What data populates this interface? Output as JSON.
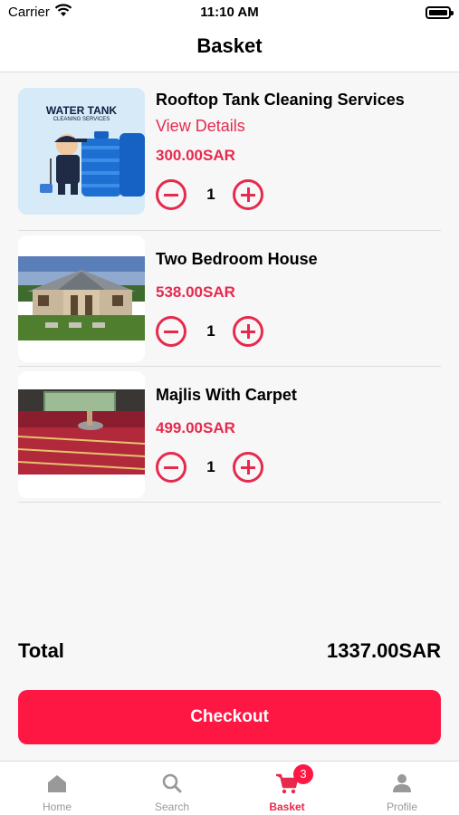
{
  "status_bar": {
    "carrier": "Carrier",
    "time": "11:10 AM"
  },
  "header": {
    "title": "Basket"
  },
  "items": [
    {
      "name": "Rooftop Tank Cleaning Services",
      "details_link": "View Details",
      "price": "300.00SAR",
      "quantity": "1",
      "image_text": {
        "title": "WATER TANK",
        "subtitle": "CLEANING SERVICES"
      }
    },
    {
      "name": "Two Bedroom House",
      "price": "538.00SAR",
      "quantity": "1"
    },
    {
      "name": "Majlis With Carpet",
      "price": "499.00SAR",
      "quantity": "1"
    }
  ],
  "summary": {
    "total_label": "Total",
    "total_value": "1337.00SAR"
  },
  "checkout_label": "Checkout",
  "tabs": [
    {
      "label": "Home",
      "icon": "home-icon"
    },
    {
      "label": "Search",
      "icon": "search-icon"
    },
    {
      "label": "Basket",
      "icon": "cart-icon",
      "badge": "3",
      "active": true
    },
    {
      "label": "Profile",
      "icon": "profile-icon"
    }
  ],
  "colors": {
    "accent": "#e62a4e",
    "checkout": "#ff1744",
    "background": "#f7f7f7"
  }
}
